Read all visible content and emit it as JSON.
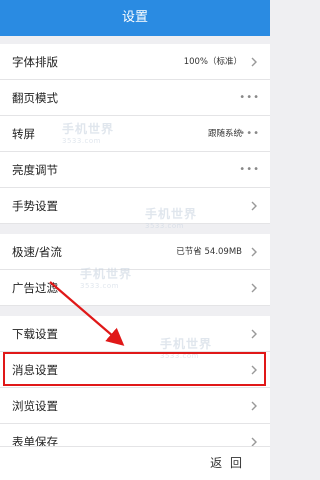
{
  "header": {
    "title": "设置"
  },
  "rows": [
    {
      "label": "字体排版",
      "value": "100%（标准）",
      "trail": "chevron"
    },
    {
      "label": "翻页模式",
      "value": "",
      "trail": "dots"
    },
    {
      "label": "转屏",
      "value": "跟随系统",
      "trail": "dots"
    },
    {
      "label": "亮度调节",
      "value": "",
      "trail": "dots"
    },
    {
      "label": "手势设置",
      "value": "",
      "trail": "chevron"
    },
    {
      "label": "极速/省流",
      "value": "已节省 54.09MB",
      "trail": "chevron"
    },
    {
      "label": "广告过滤",
      "value": "",
      "trail": "chevron"
    },
    {
      "label": "下载设置",
      "value": "",
      "trail": "chevron"
    },
    {
      "label": "消息设置",
      "value": "",
      "trail": "chevron"
    },
    {
      "label": "浏览设置",
      "value": "",
      "trail": "chevron"
    },
    {
      "label": "表单保存",
      "value": "",
      "trail": "chevron"
    }
  ],
  "footer": {
    "back_label": "返 回"
  },
  "watermark": {
    "text": "手机世界",
    "sub": "3533.com"
  },
  "colors": {
    "header": "#2a8be2",
    "highlight": "#e01818",
    "arrow": "#e01818"
  }
}
